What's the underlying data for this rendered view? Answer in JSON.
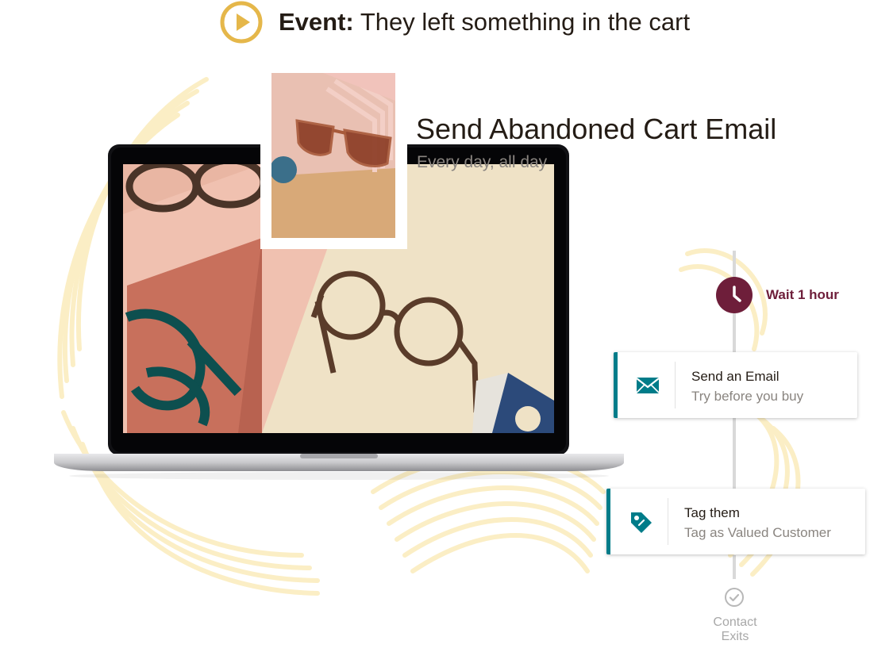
{
  "event": {
    "label": "Event:",
    "description": "They left something in the cart",
    "icon": "play-circle-icon"
  },
  "campaign": {
    "title": "Send Abandoned Cart Email",
    "schedule": "Every day, all day"
  },
  "workflow": {
    "wait": {
      "label": "Wait 1 hour",
      "icon": "clock-icon"
    },
    "steps": [
      {
        "title": "Send an Email",
        "subtitle": "Try before you buy",
        "icon": "envelope-icon"
      },
      {
        "title": "Tag them",
        "subtitle": "Tag as Valued Customer",
        "icon": "tag-icon"
      }
    ],
    "exit": {
      "label": "Contact Exits",
      "icon": "check-circle-icon"
    }
  },
  "colors": {
    "accent_gold": "#e5b74a",
    "brand_plum": "#6e1e3a",
    "teal": "#007c89",
    "text_dark": "#241c15",
    "text_muted": "#8a8580"
  }
}
